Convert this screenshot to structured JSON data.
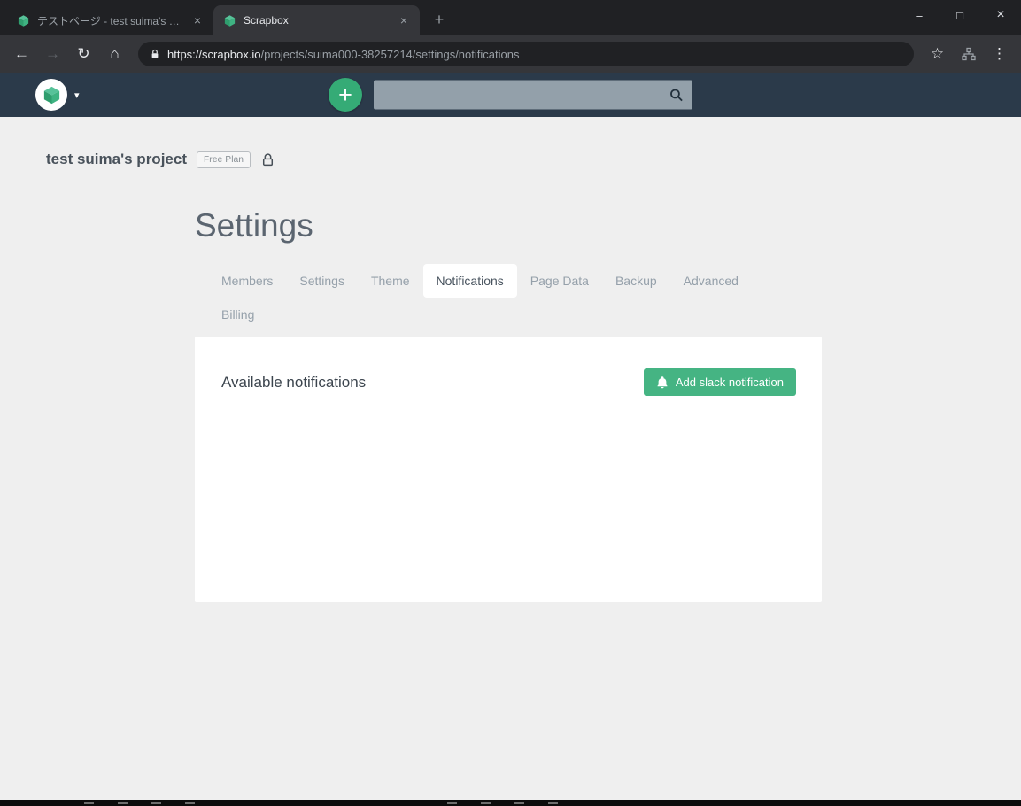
{
  "browser": {
    "tabs": [
      {
        "title": "テストページ - test suima's project",
        "active": false
      },
      {
        "title": "Scrapbox",
        "active": true
      }
    ],
    "url": {
      "host": "https://scrapbox.io",
      "path": "/projects/suima000-38257214/settings/notifications"
    }
  },
  "icons": {
    "back": "←",
    "forward": "→",
    "reload": "↻",
    "home": "⌂",
    "star": "☆",
    "overflow_menu": "⋮",
    "tab_close": "×",
    "new_tab": "+",
    "window_minimize": "–",
    "window_maximize": "□",
    "window_close": "×",
    "chevron_down": "▾",
    "add_plus": "+"
  },
  "header": {
    "search": {
      "value": "",
      "placeholder": ""
    }
  },
  "page": {
    "project_title": "test suima's project",
    "plan_badge": "Free Plan",
    "heading": "Settings",
    "tabs": [
      {
        "label": "Members",
        "active": false
      },
      {
        "label": "Settings",
        "active": false
      },
      {
        "label": "Theme",
        "active": false
      },
      {
        "label": "Notifications",
        "active": true
      },
      {
        "label": "Page Data",
        "active": false
      },
      {
        "label": "Backup",
        "active": false
      },
      {
        "label": "Advanced",
        "active": false
      },
      {
        "label": "Billing",
        "active": false
      }
    ],
    "panel": {
      "title": "Available notifications",
      "add_button_label": "Add slack notification"
    }
  },
  "colors": {
    "brand_green": "#45b483",
    "plus_green": "#35ab76",
    "header_navy": "#2b3a4a",
    "browser_frame": "#202124",
    "browser_toolbar": "#35363a",
    "page_background": "#efefef"
  }
}
